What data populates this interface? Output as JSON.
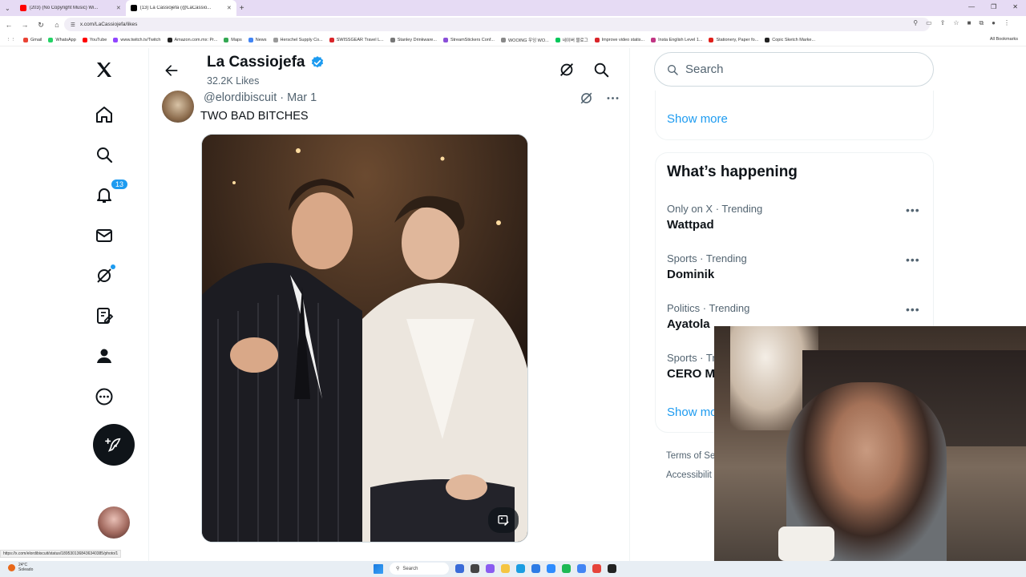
{
  "browser": {
    "tabs": [
      {
        "title": "(203) (No Copyright Music) Wi...",
        "favicon_color": "#ff0000",
        "active": false
      },
      {
        "title": "(13) La Cassiojefa (@LaCassio...",
        "favicon_color": "#000000",
        "active": true
      }
    ],
    "url": "x.com/LaCassiojefa/likes",
    "bookmarks": [
      {
        "label": "Gmail",
        "color": "#ea4335"
      },
      {
        "label": "WhatsApp",
        "color": "#25d366"
      },
      {
        "label": "YouTube",
        "color": "#ff0000"
      },
      {
        "label": "www.twitch.tv/Twitch",
        "color": "#9146ff"
      },
      {
        "label": "Amazon.com.mx: Pr...",
        "color": "#222222"
      },
      {
        "label": "Maps",
        "color": "#34a853"
      },
      {
        "label": "News",
        "color": "#4285f4"
      },
      {
        "label": "Herschel Supply Co...",
        "color": "#999999"
      },
      {
        "label": "SWISSGEAR Travel L...",
        "color": "#d9252a"
      },
      {
        "label": "Stanley Drinkware...",
        "color": "#777777"
      },
      {
        "label": "StreamStickers Conf...",
        "color": "#8a4fd8"
      },
      {
        "label": "WOOING 우잉 WO...",
        "color": "#888888"
      },
      {
        "label": "네이버 블로그",
        "color": "#03c75a"
      },
      {
        "label": "Improve video statis...",
        "color": "#d9252a"
      },
      {
        "label": "Insta English Level 1...",
        "color": "#c13584"
      },
      {
        "label": "Stationery, Paper fo...",
        "color": "#e0201b"
      },
      {
        "label": "Copic Sketch Marke...",
        "color": "#222222"
      }
    ],
    "all_bookmarks": "All Bookmarks",
    "status_url": "https://x.com/elordibiscuit/status/1895301368436340385/photo/1"
  },
  "nav": {
    "notifications_count": "13"
  },
  "profile": {
    "name": "La Cassiojefa",
    "likes_count": "32.2K Likes"
  },
  "tweet": {
    "handle": "@elordibiscuit",
    "date": "Mar 1",
    "meta": "@elordibiscuit · Mar 1",
    "text": "TWO BAD BITCHES"
  },
  "right": {
    "search_placeholder": "Search",
    "show_more_top": "Show more",
    "whats_happening": "What’s happening",
    "trends": [
      {
        "context": "Only on X · Trending",
        "name": "Wattpad"
      },
      {
        "context": "Sports · Trending",
        "name": "Dominik"
      },
      {
        "context": "Politics · Trending",
        "name": "Ayatola"
      },
      {
        "context": "Sports · Tr",
        "name": "CERO M"
      }
    ],
    "show_more_bottom": "Show mo",
    "footer_terms": "Terms of Se",
    "footer_access": "Accessibilit"
  },
  "taskbar": {
    "temperature": "24°C",
    "weather": "Soleado",
    "search": "Search"
  },
  "colors": {
    "accent": "#1d9bf0",
    "text_primary": "#0f1419",
    "text_secondary": "#536471"
  }
}
